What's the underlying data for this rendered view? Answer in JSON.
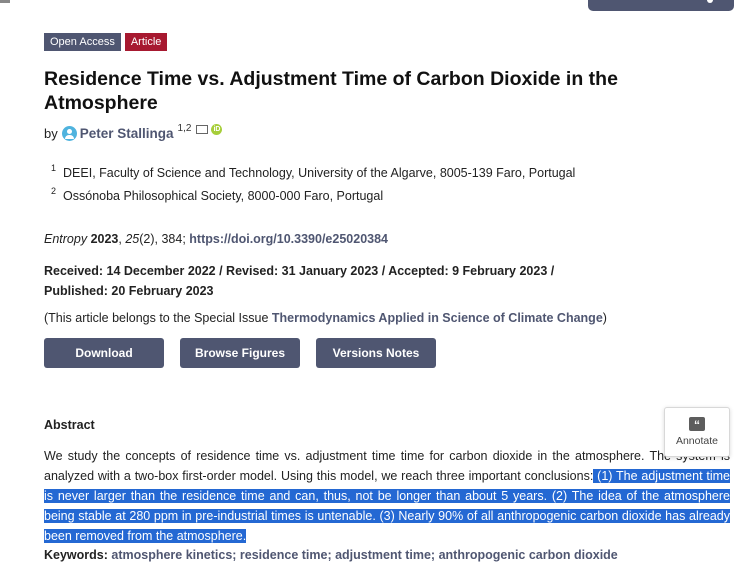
{
  "badges": {
    "open_access": "Open Access",
    "article": "Article"
  },
  "title": "Residence Time vs. Adjustment Time of Carbon Dioxide in the Atmosphere",
  "byline": {
    "prefix": "by",
    "author": "Peter Stallinga",
    "affil_refs": "1,2"
  },
  "affiliations": [
    {
      "num": "1",
      "text": "DEEI, Faculty of Science and Technology, University of the Algarve, 8005-139 Faro, Portugal"
    },
    {
      "num": "2",
      "text": "Ossónoba Philosophical Society, 8000-000 Faro, Portugal"
    }
  ],
  "citation": {
    "journal": "Entropy",
    "year": "2023",
    "volume": "25",
    "rest": "(2), 384;",
    "doi": "https://doi.org/10.3390/e25020384"
  },
  "dates": "Received: 14 December 2022 / Revised: 31 January 2023 / Accepted: 9 February 2023 / Published: 20 February 2023",
  "special_issue": {
    "prefix": "(This article belongs to the Special Issue ",
    "name": "Thermodynamics Applied in Science of Climate Change",
    "suffix": ")"
  },
  "buttons": {
    "download": "Download",
    "browse_figures": "Browse Figures",
    "versions_notes": "Versions Notes"
  },
  "abstract": {
    "heading": "Abstract",
    "text_plain": "We study the concepts of residence time vs. adjustment time time for carbon dioxide in the atmosphere. The system is analyzed with a two-box first-order model. Using this model, we reach three important conclusions:",
    "text_highlighted": " (1) The adjustment time is never larger than the residence time and can, thus, not be longer than about 5 years. (2) The idea of the atmosphere being stable at 280 ppm in pre-industrial times is untenable. (3) Nearly 90% of all anthropogenic carbon dioxide has already been removed from the atmosphere."
  },
  "annotate": {
    "label": "Annotate",
    "icon": "quote-icon"
  },
  "keywords": {
    "label": "Keywords:",
    "values": "atmosphere kinetics; residence time; adjustment time; anthropogenic carbon dioxide"
  }
}
